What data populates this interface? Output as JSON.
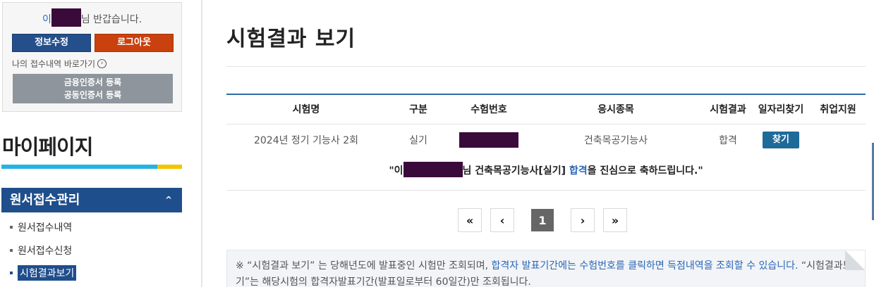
{
  "sidebar": {
    "greeting": {
      "name_first": "이",
      "suffix": "님 반갑습니다."
    },
    "edit_label": "정보수정",
    "logout_label": "로그아웃",
    "my_receipt_label": "나의 접수내역 바로가기",
    "cert_line1": "금융인증서 등록",
    "cert_line2": "공동인증서 등록",
    "mypage_title": "마이페이지",
    "menu_head": "원서접수관리",
    "items": [
      {
        "label": "원서접수내역"
      },
      {
        "label": "원서접수신청"
      },
      {
        "label": "시험결과보기"
      }
    ]
  },
  "main": {
    "title": "시험결과 보기",
    "table": {
      "headers": [
        "시험명",
        "구분",
        "수험번호",
        "응시종목",
        "시험결과",
        "일자리찾기",
        "취업지원"
      ],
      "row": {
        "exam": "2024년 정기 기능사 2회",
        "type": "실기",
        "subject": "건축목공기능사",
        "result": "합격",
        "find_label": "찾기"
      },
      "congrats": {
        "open": "\"이",
        "middle": "님 건축목공기능사[실기] ",
        "result_word": "합격",
        "close": "을 진심으로 축하드립니다.\""
      }
    },
    "pager": {
      "first": "«",
      "prev": "‹",
      "current": "1",
      "next": "›",
      "last": "»"
    },
    "notice": {
      "p1": "※ “시험결과 보기” 는 당해년도에 발표중인 시험만 조회되며, ",
      "hl": "합격자 발표기간에는 수험번호를 클릭하면 득점내역을 조회할 수 있습니다.",
      "p2": " “시험결과보기”는 해당시험의 합격자발표기간(발표일로부터 60일간)만 조회됩니다."
    }
  },
  "colors": {
    "brand_blue": "#1f4e8c",
    "logout_orange": "#c9410e",
    "accent_cyan": "#26b2e2",
    "accent_yellow": "#f3c400"
  }
}
